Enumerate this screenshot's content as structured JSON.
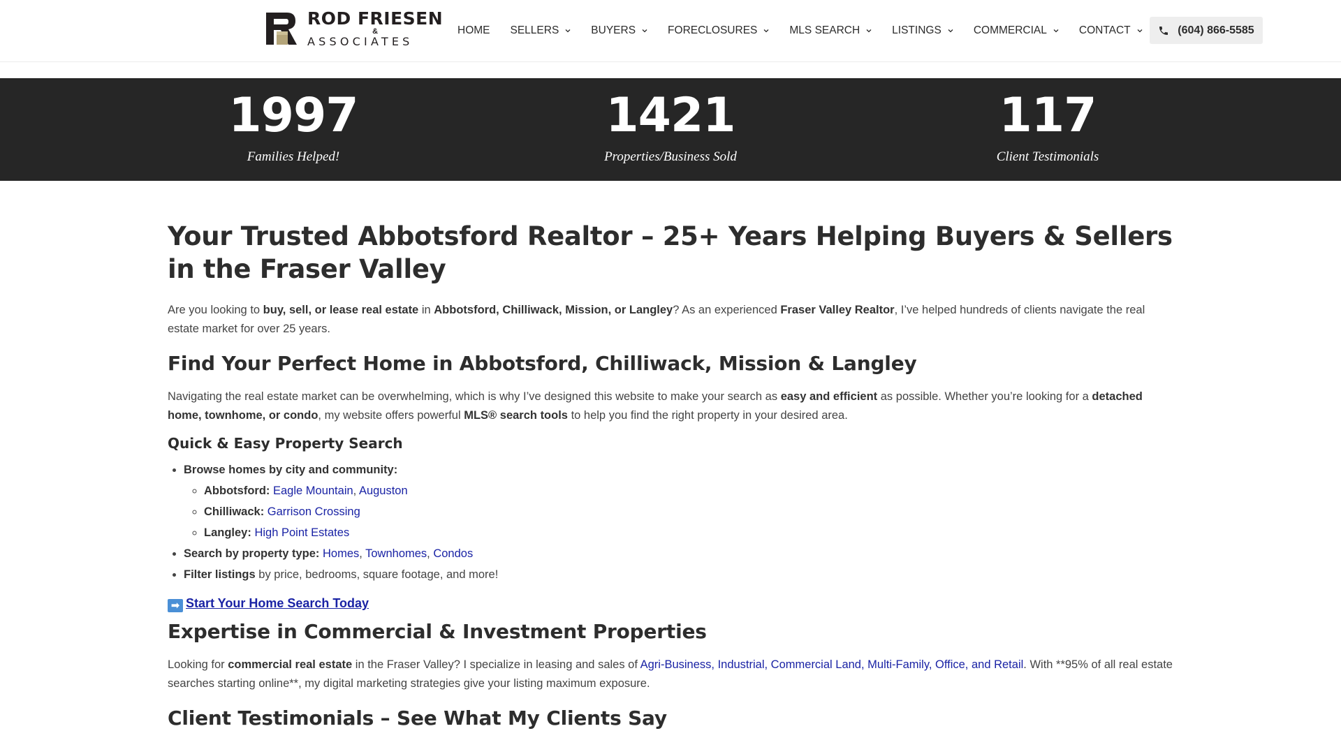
{
  "header": {
    "logo": {
      "line1": "ROD FRIESEN",
      "amp": "&",
      "line2": "ASSOCIATES"
    },
    "nav": [
      {
        "label": "HOME",
        "dropdown": false
      },
      {
        "label": "SELLERS",
        "dropdown": true
      },
      {
        "label": "BUYERS",
        "dropdown": true
      },
      {
        "label": "FORECLOSURES",
        "dropdown": true
      },
      {
        "label": "MLS SEARCH",
        "dropdown": true
      },
      {
        "label": "LISTINGS",
        "dropdown": true
      },
      {
        "label": "COMMERCIAL",
        "dropdown": true
      },
      {
        "label": "CONTACT",
        "dropdown": true
      }
    ],
    "phone": {
      "icon": "phone-icon",
      "label": "(604) 866-5585"
    }
  },
  "stats": [
    {
      "value": "1997",
      "label": "Families Helped!"
    },
    {
      "value": "1421",
      "label": "Properties/Business Sold"
    },
    {
      "value": "117",
      "label": "Client Testimonials"
    }
  ],
  "content": {
    "title": "Your Trusted Abbotsford Realtor – 25+ Years Helping Buyers & Sellers in the Fraser Valley",
    "intro": {
      "t1": "Are you looking to ",
      "b1": "buy, sell, or lease real estate",
      "t2": " in ",
      "b2": "Abbotsford, Chilliwack, Mission, or Langley",
      "t3": "? As an experienced ",
      "b3": "Fraser Valley Realtor",
      "t4": ", I’ve helped hundreds of clients navigate the real estate market for over 25 years."
    },
    "h2_find": "Find Your Perfect Home in Abbotsford, Chilliwack, Mission & Langley",
    "navigating": {
      "t1": "Navigating the real estate market can be overwhelming, which is why I’ve designed this website to make your search as ",
      "b1": "easy and efficient",
      "t2": " as possible. Whether you’re looking for a ",
      "b2": "detached home, townhome, or condo",
      "t3": ", my website offers powerful ",
      "b3": "MLS® search tools",
      "t4": " to help you find the right property in your desired area."
    },
    "h3_quick": "Quick & Easy Property Search",
    "list": {
      "browse": "Browse homes by city and community:",
      "abbotsford_label": "Abbotsford:",
      "abbotsford_links": [
        "Eagle Mountain",
        "Auguston"
      ],
      "chilliwack_label": "Chilliwack:",
      "chilliwack_links": [
        "Garrison Crossing"
      ],
      "langley_label": "Langley:",
      "langley_links": [
        "High Point Estates"
      ],
      "type_label": "Search by property type:",
      "type_links": [
        "Homes",
        "Townhomes",
        "Condos"
      ],
      "filter_bold": "Filter listings",
      "filter_rest": " by price, bedrooms, square footage, and more!",
      "comma": ", "
    },
    "cta": {
      "arrow": "➡",
      "label": "Start Your Home Search Today"
    },
    "h2_commercial": "Expertise in Commercial & Investment Properties",
    "commercial": {
      "t1": "Looking for ",
      "b1": "commercial real estate",
      "t2": " in the Fraser Valley? I specialize in leasing and sales of ",
      "link": "Agri-Business, Industrial, Commercial Land, Multi-Family, Office, and Retail",
      "t3": ". With **95% of all real estate searches starting online**, my digital marketing strategies give your listing maximum exposure."
    },
    "h2_testimonials": "Client Testimonials – See What My Clients Say"
  },
  "colors": {
    "stats_band": "#262626",
    "link": "#1a23a5",
    "logo_accent": "#b4a57a",
    "logo_dark": "#231f20",
    "phone_button": "#eeeeee"
  }
}
